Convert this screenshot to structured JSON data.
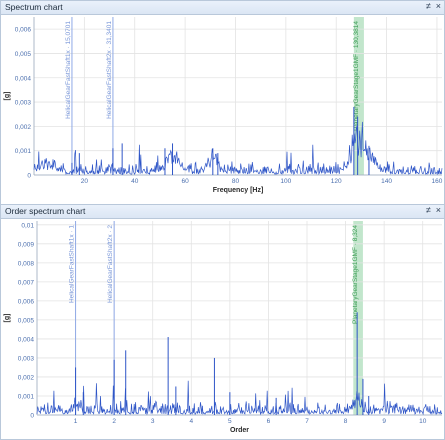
{
  "colors": {
    "signal": "#2e55c7",
    "grid": "#e3e3e3",
    "cursor": "#8fa9e6",
    "band": "#78c88e",
    "band_text": "#3d9d55"
  },
  "panels": [
    {
      "title": "Spectrum chart",
      "pin": "≠",
      "close": "×",
      "x_title": "Frequency [Hz]",
      "y_title": "[g]",
      "chart_data": {
        "type": "line",
        "xlim": [
          0,
          162
        ],
        "ylim": [
          0,
          0.0065
        ],
        "x_ticks": [
          "20",
          "40",
          "60",
          "80",
          "100",
          "120",
          "140",
          "160"
        ],
        "x_tick_values": [
          20,
          40,
          60,
          80,
          100,
          120,
          140,
          160
        ],
        "y_ticks": [
          "0",
          "0,001",
          "0,002",
          "0,003",
          "0,004",
          "0,005",
          "0,006"
        ],
        "y_tick_values": [
          0,
          0.001,
          0.002,
          0.003,
          0.004,
          0.005,
          0.006
        ],
        "markers": [
          {
            "x": 15.07,
            "label": "HelicalGearFastShaft1x · 15,0701"
          },
          {
            "x": 31.34,
            "label": "HelicalGearFastShaft2x · 31,3401"
          }
        ],
        "band": {
          "x1": 127,
          "x2": 131,
          "label": "PlanetaryGearStage1GMF · 130,3814"
        },
        "peaks": [
          [
            15.07,
            0.0005
          ],
          [
            18,
            0.0009
          ],
          [
            31.34,
            0.0011
          ],
          [
            35,
            0.0013
          ],
          [
            52,
            0.0011
          ],
          [
            55,
            0.0013
          ],
          [
            71,
            0.0011
          ],
          [
            73,
            0.0009
          ],
          [
            127,
            0.0028
          ],
          [
            128.5,
            0.0024
          ],
          [
            133,
            0.0012
          ]
        ],
        "humps": [
          [
            5,
            0.0003,
            4
          ],
          [
            55,
            0.0006,
            4
          ],
          [
            71,
            0.0005,
            3
          ],
          [
            128,
            0.0012,
            3
          ],
          [
            133,
            0.0006,
            4
          ]
        ],
        "noise": 0.00018
      }
    },
    {
      "title": "Order spectrum chart",
      "pin": "≠",
      "close": "×",
      "x_title": "Order",
      "y_title": "[g]",
      "chart_data": {
        "type": "line",
        "xlim": [
          0,
          10.5
        ],
        "ylim": [
          0,
          0.0102
        ],
        "x_ticks": [
          "1",
          "2",
          "3",
          "4",
          "5",
          "6",
          "7",
          "8",
          "9",
          "10"
        ],
        "x_tick_values": [
          1,
          2,
          3,
          4,
          5,
          6,
          7,
          8,
          9,
          10
        ],
        "y_ticks": [
          "0",
          "0,001",
          "0,002",
          "0,003",
          "0,004",
          "0,005",
          "0,006",
          "0,007",
          "0,008",
          "0,009",
          "0,01"
        ],
        "y_tick_values": [
          0,
          0.001,
          0.002,
          0.003,
          0.004,
          0.005,
          0.006,
          0.007,
          0.008,
          0.009,
          0.01
        ],
        "markers": [
          {
            "x": 1.0,
            "label": "HelicalGearFastShaft1x · 1"
          },
          {
            "x": 2.0,
            "label": "HelicalGearFastShaft2x · 2"
          }
        ],
        "band": {
          "x1": 8.2,
          "x2": 8.45,
          "label": "PlanetaryGearStage1GMF · 8,324"
        },
        "peaks": [
          [
            1.0,
            0.0025
          ],
          [
            1.2,
            0.0012
          ],
          [
            2.0,
            0.0029
          ],
          [
            2.3,
            0.0034
          ],
          [
            3.4,
            0.0041
          ],
          [
            3.6,
            0.0015
          ],
          [
            4.6,
            0.003
          ],
          [
            5.0,
            0.0012
          ],
          [
            6.2,
            0.0009
          ],
          [
            8.3,
            0.0054
          ],
          [
            8.45,
            0.0019
          ],
          [
            8.6,
            0.001
          ]
        ],
        "humps": [
          [
            1.0,
            0.0004,
            0.12
          ],
          [
            8.3,
            0.0006,
            0.12
          ]
        ],
        "noise": 0.00025
      }
    }
  ]
}
